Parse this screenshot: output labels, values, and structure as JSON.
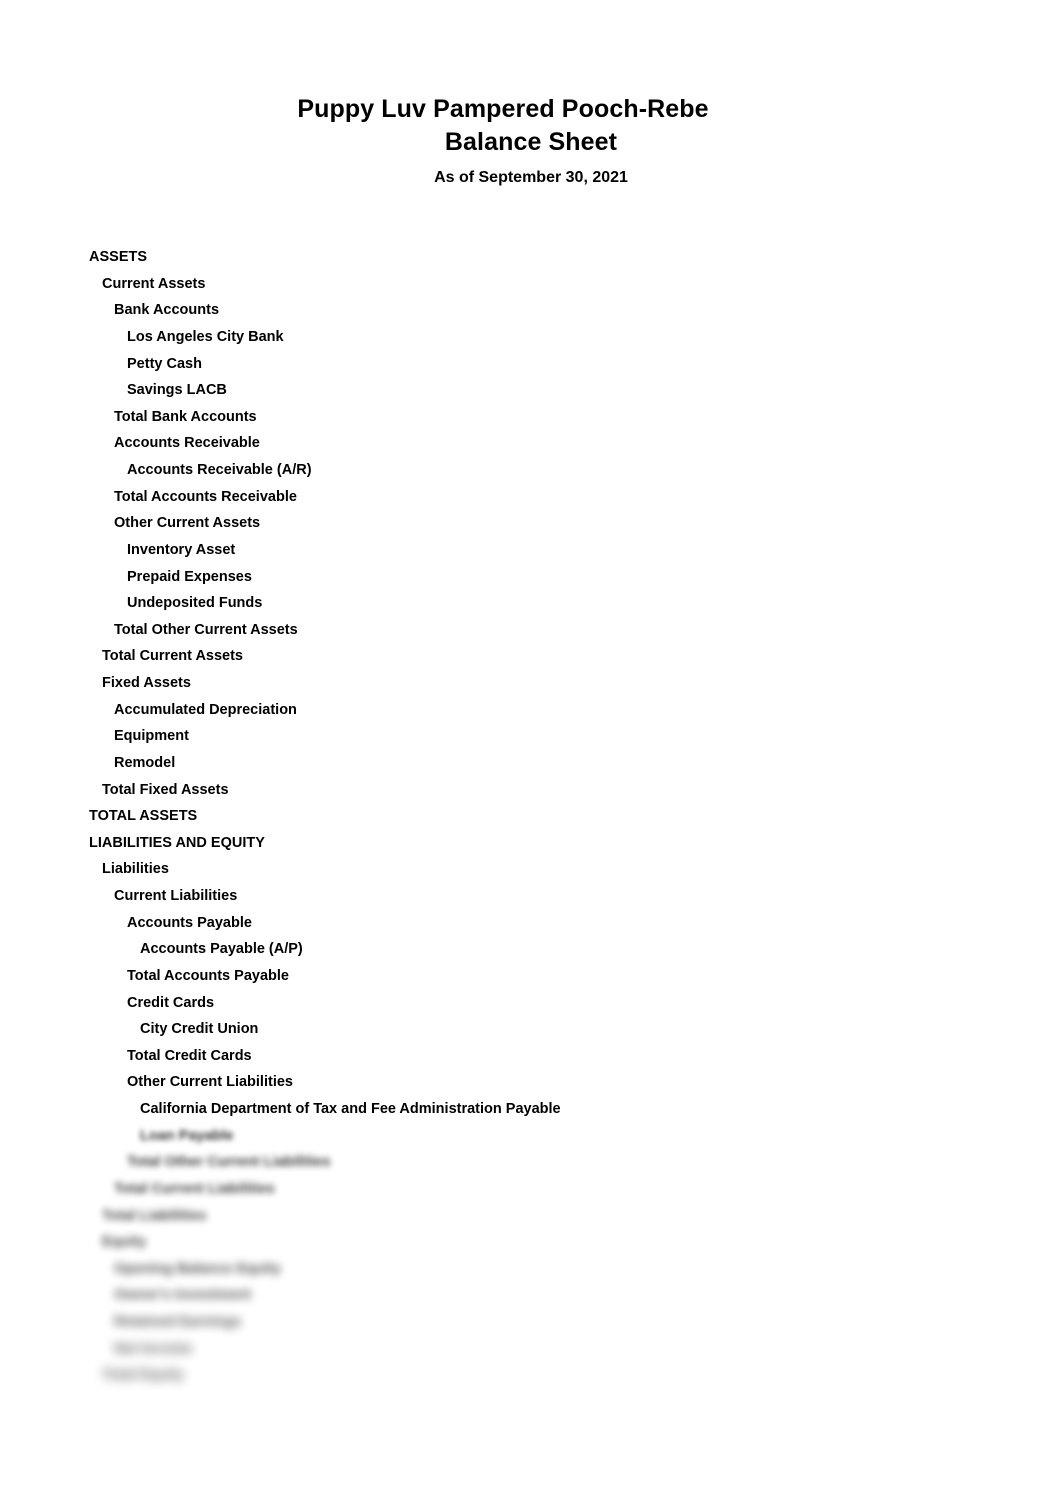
{
  "document": {
    "company_name": "Puppy Luv Pampered Pooch-Rebe",
    "report_title": "Balance Sheet",
    "report_period": "As of September 30, 2021"
  },
  "rows": [
    {
      "label": "ASSETS",
      "indent": 0,
      "blur": 0
    },
    {
      "label": "Current Assets",
      "indent": 1,
      "blur": 0
    },
    {
      "label": "Bank Accounts",
      "indent": 2,
      "blur": 0
    },
    {
      "label": "Los Angeles City Bank",
      "indent": 3,
      "blur": 0
    },
    {
      "label": "Petty Cash",
      "indent": 3,
      "blur": 0
    },
    {
      "label": "Savings LACB",
      "indent": 3,
      "blur": 0
    },
    {
      "label": "Total Bank Accounts",
      "indent": 2,
      "blur": 0
    },
    {
      "label": "Accounts Receivable",
      "indent": 2,
      "blur": 0
    },
    {
      "label": "Accounts Receivable (A/R)",
      "indent": 3,
      "blur": 0
    },
    {
      "label": "Total Accounts Receivable",
      "indent": 2,
      "blur": 0
    },
    {
      "label": "Other Current Assets",
      "indent": 2,
      "blur": 0
    },
    {
      "label": "Inventory Asset",
      "indent": 3,
      "blur": 0
    },
    {
      "label": "Prepaid Expenses",
      "indent": 3,
      "blur": 0
    },
    {
      "label": "Undeposited Funds",
      "indent": 3,
      "blur": 0
    },
    {
      "label": "Total Other Current Assets",
      "indent": 2,
      "blur": 0
    },
    {
      "label": "Total Current Assets",
      "indent": 1,
      "blur": 0
    },
    {
      "label": "Fixed Assets",
      "indent": 1,
      "blur": 0
    },
    {
      "label": "Accumulated Depreciation",
      "indent": 2,
      "blur": 0
    },
    {
      "label": "Equipment",
      "indent": 2,
      "blur": 0
    },
    {
      "label": "Remodel",
      "indent": 2,
      "blur": 0
    },
    {
      "label": "Total Fixed Assets",
      "indent": 1,
      "blur": 0
    },
    {
      "label": "TOTAL ASSETS",
      "indent": 0,
      "blur": 0
    },
    {
      "label": "LIABILITIES AND EQUITY",
      "indent": 0,
      "blur": 0
    },
    {
      "label": "Liabilities",
      "indent": 1,
      "blur": 0
    },
    {
      "label": "Current Liabilities",
      "indent": 2,
      "blur": 0
    },
    {
      "label": "Accounts Payable",
      "indent": 3,
      "blur": 0
    },
    {
      "label": "Accounts Payable (A/P)",
      "indent": 4,
      "blur": 0
    },
    {
      "label": "Total Accounts Payable",
      "indent": 3,
      "blur": 0
    },
    {
      "label": "Credit Cards",
      "indent": 3,
      "blur": 0
    },
    {
      "label": "City Credit Union",
      "indent": 4,
      "blur": 0
    },
    {
      "label": "Total Credit Cards",
      "indent": 3,
      "blur": 0
    },
    {
      "label": "Other Current Liabilities",
      "indent": 3,
      "blur": 0
    },
    {
      "label": "California Department of Tax and Fee Administration Payable",
      "indent": 4,
      "blur": 0
    },
    {
      "label": "Loan Payable",
      "indent": 4,
      "blur": 1
    },
    {
      "label": "Total Other Current Liabilities",
      "indent": 3,
      "blur": 2
    },
    {
      "label": "Total Current Liabilities",
      "indent": 2,
      "blur": 3
    },
    {
      "label": "Total Liabilities",
      "indent": 1,
      "blur": 4
    },
    {
      "label": "Equity",
      "indent": 1,
      "blur": 5
    },
    {
      "label": "Opening Balance Equity",
      "indent": 2,
      "blur": 6
    },
    {
      "label": "Owner's Investment",
      "indent": 2,
      "blur": 7
    },
    {
      "label": "Retained Earnings",
      "indent": 2,
      "blur": 8
    },
    {
      "label": "Net Income",
      "indent": 2,
      "blur": 9
    },
    {
      "label": "Total Equity",
      "indent": 1,
      "blur": 10
    }
  ]
}
